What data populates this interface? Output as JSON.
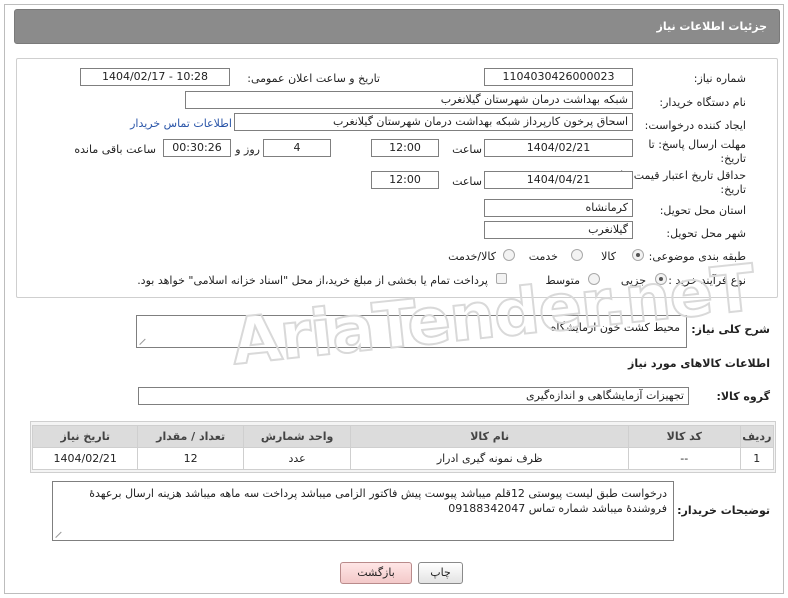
{
  "header": {
    "title": "جزئیات اطلاعات نیاز"
  },
  "form": {
    "need_number": {
      "label": "شماره نیاز:",
      "value": "1104030426000023"
    },
    "announce": {
      "label": "تاریخ و ساعت اعلان عمومی:",
      "value": "1404/02/17 - 10:28"
    },
    "buyer_org": {
      "label": "نام دستگاه خریدار:",
      "value": "شبکه بهداشت درمان شهرستان گیلانغرب"
    },
    "requester": {
      "label": "ایجاد کننده درخواست:",
      "value": "اسحاق پرخون کارپرداز شبکه بهداشت درمان شهرستان گیلانغرب",
      "contact_link": "اطلاعات تماس خریدار"
    },
    "deadline": {
      "label": "مهلت ارسال پاسخ: تا تاریخ:",
      "date": "1404/02/21",
      "time_label": "ساعت",
      "time": "12:00",
      "days": "4",
      "days_label": "روز و",
      "remaining": "00:30:26",
      "remaining_label": "ساعت باقی مانده"
    },
    "validity": {
      "label": "حداقل تاریخ اعتبار قیمت: تا تاریخ:",
      "date": "1404/04/21",
      "time_label": "ساعت",
      "time": "12:00"
    },
    "province": {
      "label": "استان محل تحویل:",
      "value": "کرمانشاه"
    },
    "city": {
      "label": "شهر محل تحویل:",
      "value": "گیلانغرب"
    },
    "category": {
      "label": "طبقه بندی موضوعی:",
      "options": [
        "کالا",
        "خدمت",
        "کالا/خدمت"
      ],
      "selected": "کالا"
    },
    "purchase_type": {
      "label": "نوع فرآیند خرید :",
      "options": [
        "جزیی",
        "متوسط"
      ],
      "selected": "جزیی",
      "note": "پرداخت تمام یا بخشی از مبلغ خرید،از محل \"اسناد خزانه اسلامی\" خواهد بود."
    }
  },
  "summary": {
    "label": "شرح کلی نیاز:",
    "value": "محیط کشت خون ازمایشگاه"
  },
  "goods_section": {
    "title": "اطلاعات کالاهای مورد نیاز"
  },
  "goods_group": {
    "label": "گروه کالا:",
    "value": "تجهیزات آزمایشگاهی و اندازه‌گیری"
  },
  "table": {
    "headers": [
      "ردیف",
      "کد کالا",
      "نام کالا",
      "واحد شمارش",
      "تعداد / مقدار",
      "تاریخ نیاز"
    ],
    "rows": [
      {
        "row": "1",
        "code": "--",
        "name": "ظرف نمونه گیری ادرار",
        "unit": "عدد",
        "qty": "12",
        "date": "1404/02/21"
      }
    ]
  },
  "buyer_notes": {
    "label": "توضیحات خریدار:",
    "value": "درخواست طبق لیست پیوستی 12قلم میباشد پیوست پیش فاکتور الزامی میباشد پرداخت سه ماهه میباشد هزینه ارسال برعهدۀ فروشندۀ میباشد شماره تماس 09188342047"
  },
  "buttons": {
    "print": "چاپ",
    "back": "بازگشت"
  },
  "watermark": {
    "text": "AriaTender.neT"
  }
}
